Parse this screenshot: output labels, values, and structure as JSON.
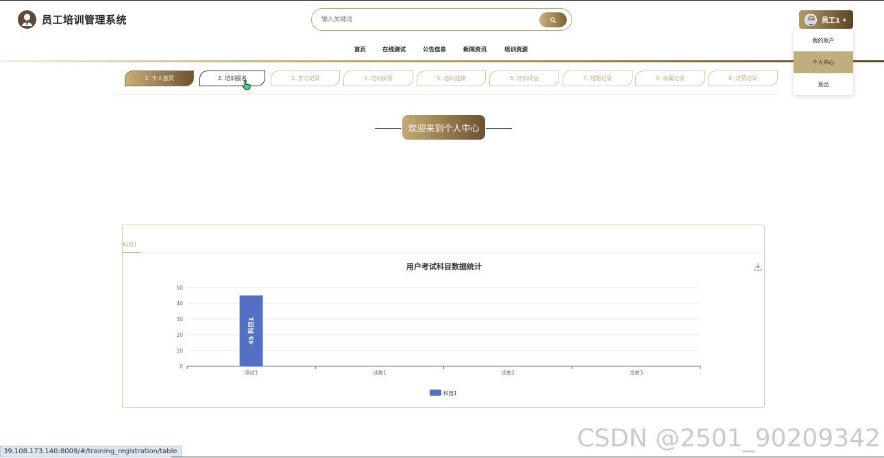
{
  "header": {
    "app_title": "员工培训管理系统",
    "search_placeholder": "输入关键词",
    "user_name": "员工1",
    "user_caret": "▲"
  },
  "user_menu": {
    "items": [
      {
        "label": "我的账户",
        "active": false
      },
      {
        "label": "个人中心",
        "active": true
      },
      {
        "label": "退出",
        "active": false
      }
    ]
  },
  "nav": {
    "items": [
      "首页",
      "在线测试",
      "公告信息",
      "新闻资讯",
      "培训资源"
    ]
  },
  "tabs": {
    "items": [
      {
        "label": "1. 个人首页",
        "state": "active"
      },
      {
        "label": "2. 培训报名",
        "state": "hover"
      },
      {
        "label": "3. 学习记录",
        "state": "normal"
      },
      {
        "label": "4. 培训反馈",
        "state": "normal"
      },
      {
        "label": "5. 培训成绩",
        "state": "normal"
      },
      {
        "label": "6. 培训评估",
        "state": "normal"
      },
      {
        "label": "7. 错题记录",
        "state": "normal"
      },
      {
        "label": "8. 收藏记录",
        "state": "normal"
      },
      {
        "label": "9. 点赞记录",
        "state": "normal"
      }
    ]
  },
  "welcome": {
    "text": "欢迎来到个人中心"
  },
  "panel": {
    "tab_label": "科目1"
  },
  "chart_data": {
    "type": "bar",
    "title": "用户考试科目数据统计",
    "categories": [
      "测试1",
      "试卷1",
      "试卷2",
      "试卷3"
    ],
    "series": [
      {
        "name": "科目1",
        "values": [
          45,
          0,
          0,
          0
        ],
        "color": "#5470c6"
      }
    ],
    "data_labels": [
      "45",
      "科目1"
    ],
    "ylim": [
      0,
      50
    ],
    "yticks": [
      0,
      10,
      20,
      30,
      40,
      50
    ],
    "grid": true,
    "legend": "bottom-center"
  },
  "status_bar": {
    "url": "39.108.173.140:8009/#/training_registration/table"
  },
  "watermark": {
    "text": "CSDN @2501_90209342"
  },
  "colors": {
    "accent_gold": "#c2ad7c",
    "accent_dark": "#6e5430",
    "bar_blue": "#5470c6"
  }
}
